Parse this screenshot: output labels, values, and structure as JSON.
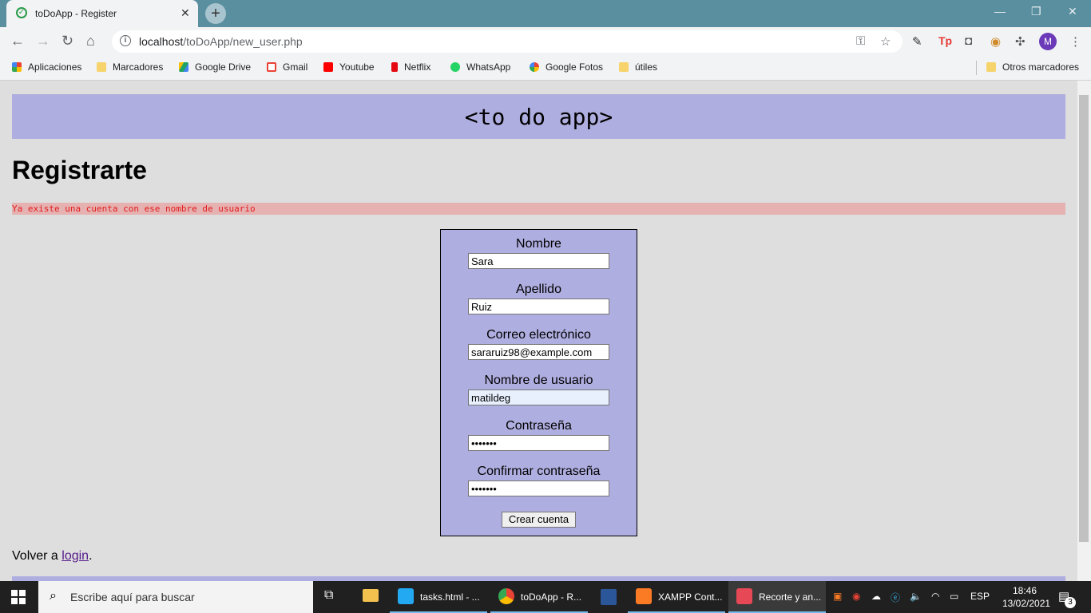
{
  "browser": {
    "tab_title": "toDoApp - Register",
    "tab_close": "✕",
    "new_tab": "+",
    "url_host": "localhost",
    "url_path": "/toDoApp/new_user.php",
    "avatar_letter": "M",
    "window_controls": [
      "—",
      "❐",
      "✕"
    ]
  },
  "bookmarks": {
    "items": [
      {
        "label": "Aplicaciones",
        "icon": "apps-grid-icon",
        "color": "#ea4335"
      },
      {
        "label": "Marcadores",
        "icon": "folder-icon",
        "color": "#f6d36b"
      },
      {
        "label": "Google Drive",
        "icon": "google-drive-icon",
        "color": "#1fa463"
      },
      {
        "label": "Gmail",
        "icon": "gmail-icon",
        "color": "#ea4335"
      },
      {
        "label": "Youtube",
        "icon": "youtube-icon",
        "color": "#ff0000"
      },
      {
        "label": "Netflix",
        "icon": "netflix-icon",
        "color": "#e50914"
      },
      {
        "label": "WhatsApp",
        "icon": "whatsapp-icon",
        "color": "#25d366"
      },
      {
        "label": "Google Fotos",
        "icon": "google-photos-icon",
        "color": "#fbbc04"
      },
      {
        "label": "útiles",
        "icon": "folder-icon",
        "color": "#f6d36b"
      }
    ],
    "other": "Otros marcadores"
  },
  "page": {
    "header": "<to do app>",
    "title": "Registrarte",
    "error": "Ya existe una cuenta con ese nombre de usuario",
    "form": {
      "nombre_label": "Nombre",
      "nombre_value": "Sara",
      "apellido_label": "Apellido",
      "apellido_value": "Ruiz",
      "email_label": "Correo electrónico",
      "email_value": "sararuiz98@example.com",
      "usuario_label": "Nombre de usuario",
      "usuario_value": "matildeg",
      "password_label": "Contraseña",
      "password_value": "•••••••",
      "confirm_label": "Confirmar contraseña",
      "confirm_value": "•••••••",
      "submit_label": "Crear cuenta"
    },
    "back_text": "Volver a ",
    "back_link": "login",
    "back_suffix": "."
  },
  "taskbar": {
    "search_placeholder": "Escribe aquí para buscar",
    "apps": [
      {
        "label": "tasks.html - ...",
        "icon": "vscode-icon",
        "color": "#23a9f2"
      },
      {
        "label": "toDoApp - R...",
        "icon": "chrome-icon",
        "color": "#ea4335"
      },
      {
        "label": "XAMPP Cont...",
        "icon": "xampp-icon",
        "color": "#fb7a24"
      },
      {
        "label": "Recorte y an...",
        "icon": "snip-sketch-icon",
        "color": "#e74856"
      }
    ],
    "language": "ESP",
    "time": "18:46",
    "date": "13/02/2021",
    "notifications": "3"
  },
  "colors": {
    "header_band": "#afaee0",
    "error_bg": "#e5b1b1",
    "error_text": "#e41c1c",
    "link": "#551a8b"
  }
}
